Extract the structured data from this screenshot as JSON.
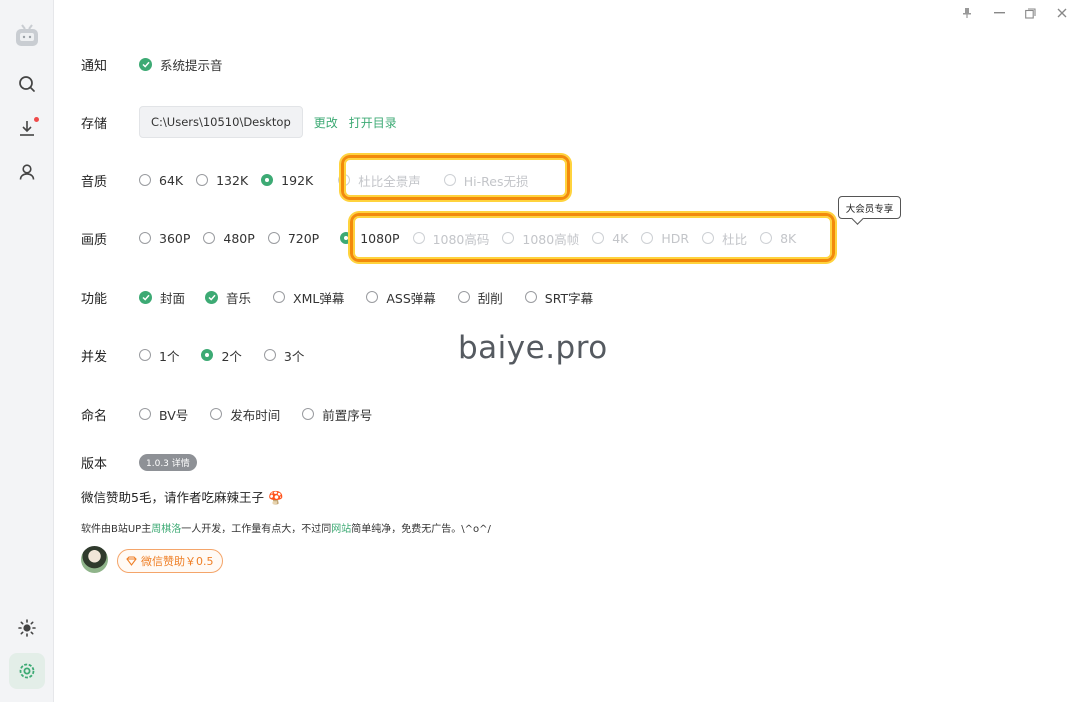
{
  "sidebar": {
    "items": [
      {
        "name": "app-logo-icon"
      },
      {
        "name": "search-icon"
      },
      {
        "name": "download-icon"
      },
      {
        "name": "user-icon"
      },
      {
        "name": "theme-icon"
      },
      {
        "name": "settings-icon"
      }
    ]
  },
  "settings": {
    "notify": {
      "label": "通知",
      "option": "系统提示音"
    },
    "storage": {
      "label": "存储",
      "path": "C:\\Users\\10510\\Desktop",
      "change": "更改",
      "open_dir": "打开目录"
    },
    "audio": {
      "label": "音质",
      "options": [
        "64K",
        "132K",
        "192K",
        "杜比全景声",
        "Hi-Res无损"
      ],
      "selected": "192K"
    },
    "video": {
      "label": "画质",
      "options": [
        "360P",
        "480P",
        "720P",
        "1080P",
        "1080高码",
        "1080高帧",
        "4K",
        "HDR",
        "杜比",
        "8K"
      ],
      "selected": "1080P",
      "tooltip": "大会员专享"
    },
    "features": {
      "label": "功能",
      "options": [
        "封面",
        "音乐",
        "XML弹幕",
        "ASS弹幕",
        "刮削",
        "SRT字幕"
      ],
      "checked": [
        "封面",
        "音乐"
      ]
    },
    "concurrency": {
      "label": "并发",
      "options": [
        "1个",
        "2个",
        "3个"
      ],
      "selected": "2个"
    },
    "naming": {
      "label": "命名",
      "options": [
        "BV号",
        "发布时间",
        "前置序号"
      ]
    },
    "version": {
      "label": "版本",
      "badge": "1.0.3 详情"
    }
  },
  "sponsor": {
    "title": "微信赞助5毛，请作者吃麻辣王子",
    "note_pre": "软件由B站UP主",
    "note_author": "周棋洛",
    "note_mid": "一人开发，工作量有点大，不过同",
    "note_site": "网站",
    "note_post": "简单纯净，免费无广告。\\^o^/",
    "button": "微信赞助￥0.5"
  },
  "watermark": "baiye.pro",
  "colors": {
    "accent": "#3daa74",
    "highlight": "#f28a0b",
    "sponsor": "#ef7f26"
  }
}
